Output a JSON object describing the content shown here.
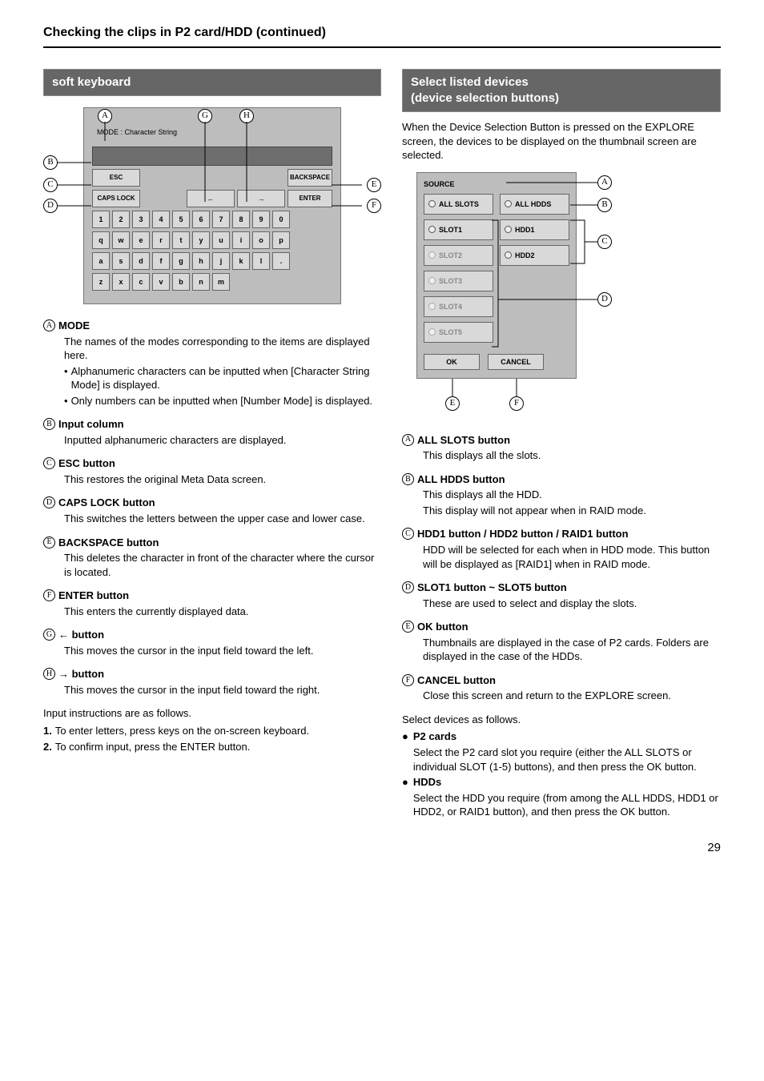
{
  "page_title": "Checking the clips in P2 card/HDD (continued)",
  "page_number": "29",
  "left": {
    "section_header": "soft keyboard",
    "keyboard": {
      "mode_label": "MODE : Character String",
      "row_numbers": [
        "1",
        "2",
        "3",
        "4",
        "5",
        "6",
        "7",
        "8",
        "9",
        "0"
      ],
      "row_q": [
        "q",
        "w",
        "e",
        "r",
        "t",
        "y",
        "u",
        "i",
        "o",
        "p"
      ],
      "row_a": [
        "a",
        "s",
        "d",
        "f",
        "g",
        "h",
        "j",
        "k",
        "l",
        "."
      ],
      "row_z": [
        "z",
        "x",
        "c",
        "v",
        "b",
        "n",
        "m"
      ],
      "esc": "ESC",
      "caps": "CAPS LOCK",
      "arrow_left": "←",
      "arrow_right": "→",
      "backspace": "BACKSPACE",
      "enter": "ENTER",
      "callouts": {
        "A": "A",
        "B": "B",
        "C": "C",
        "D": "D",
        "E": "E",
        "F": "F",
        "G": "G",
        "H": "H"
      }
    },
    "defs": {
      "A": {
        "title": "MODE",
        "body": "The names of the modes corresponding to the items are displayed here.",
        "bullets": [
          "Alphanumeric characters can be inputted when [Character String Mode] is displayed.",
          "Only numbers can be inputted when [Number Mode] is displayed."
        ]
      },
      "B": {
        "title": "Input column",
        "body": "Inputted alphanumeric characters are displayed."
      },
      "C": {
        "title": "ESC button",
        "body": "This restores the original Meta Data screen."
      },
      "D": {
        "title": "CAPS LOCK button",
        "body": "This switches the letters between the upper case and lower case."
      },
      "E": {
        "title": "BACKSPACE button",
        "body": "This deletes the character in front of the character where the cursor is located."
      },
      "F": {
        "title": "ENTER button",
        "body": "This enters the currently displayed data."
      },
      "G": {
        "title": "← button",
        "body": "This moves the cursor in the input field toward the left."
      },
      "H": {
        "title": "→ button",
        "body": "This moves the cursor in the input field toward the right."
      }
    },
    "instr_lead": "Input instructions are as follows.",
    "instr": [
      {
        "num": "1.",
        "text": "To enter letters, press keys on the on-screen keyboard."
      },
      {
        "num": "2.",
        "text": "To confirm input, press the ENTER button."
      }
    ]
  },
  "right": {
    "section_header_l1": "Select listed devices",
    "section_header_l2": "(device selection buttons)",
    "intro": "When the Device Selection Button is pressed on the EXPLORE screen, the devices to be displayed on the thumbnail screen are selected.",
    "panel": {
      "source": "SOURCE",
      "all_slots": "ALL SLOTS",
      "all_hdds": "ALL HDDS",
      "slots": [
        "SLOT1",
        "SLOT2",
        "SLOT3",
        "SLOT4",
        "SLOT5"
      ],
      "hdds": [
        "HDD1",
        "HDD2"
      ],
      "ok": "OK",
      "cancel": "CANCEL",
      "callouts": {
        "A": "A",
        "B": "B",
        "C": "C",
        "D": "D",
        "E": "E",
        "F": "F"
      }
    },
    "defs": {
      "A": {
        "title": "ALL SLOTS button",
        "body": "This displays all the slots."
      },
      "B": {
        "title": "ALL HDDS button",
        "body": "This displays all the HDD.",
        "body2": "This display will not appear when in RAID mode."
      },
      "C": {
        "title": "HDD1 button / HDD2 button / RAID1 button",
        "body": "HDD will be selected for each when in HDD mode. This button will be displayed as [RAID1] when in RAID mode."
      },
      "D": {
        "title": "SLOT1 button ~ SLOT5 button",
        "body": "These are used to select and display the slots."
      },
      "E": {
        "title": "OK button",
        "body": "Thumbnails are displayed in the case of P2 cards. Folders are displayed in the case of the HDDs."
      },
      "F": {
        "title": "CANCEL button",
        "body": "Close this screen and return to the EXPLORE screen."
      }
    },
    "sel_lead": "Select devices as follows.",
    "sel": [
      {
        "head": "P2 cards",
        "text": "Select the P2 card slot you require (either the ALL SLOTS or individual SLOT (1-5) buttons), and then press the OK button."
      },
      {
        "head": "HDDs",
        "text": "Select the HDD you require (from among the ALL HDDS, HDD1 or HDD2, or RAID1 button), and then press the OK button."
      }
    ]
  }
}
